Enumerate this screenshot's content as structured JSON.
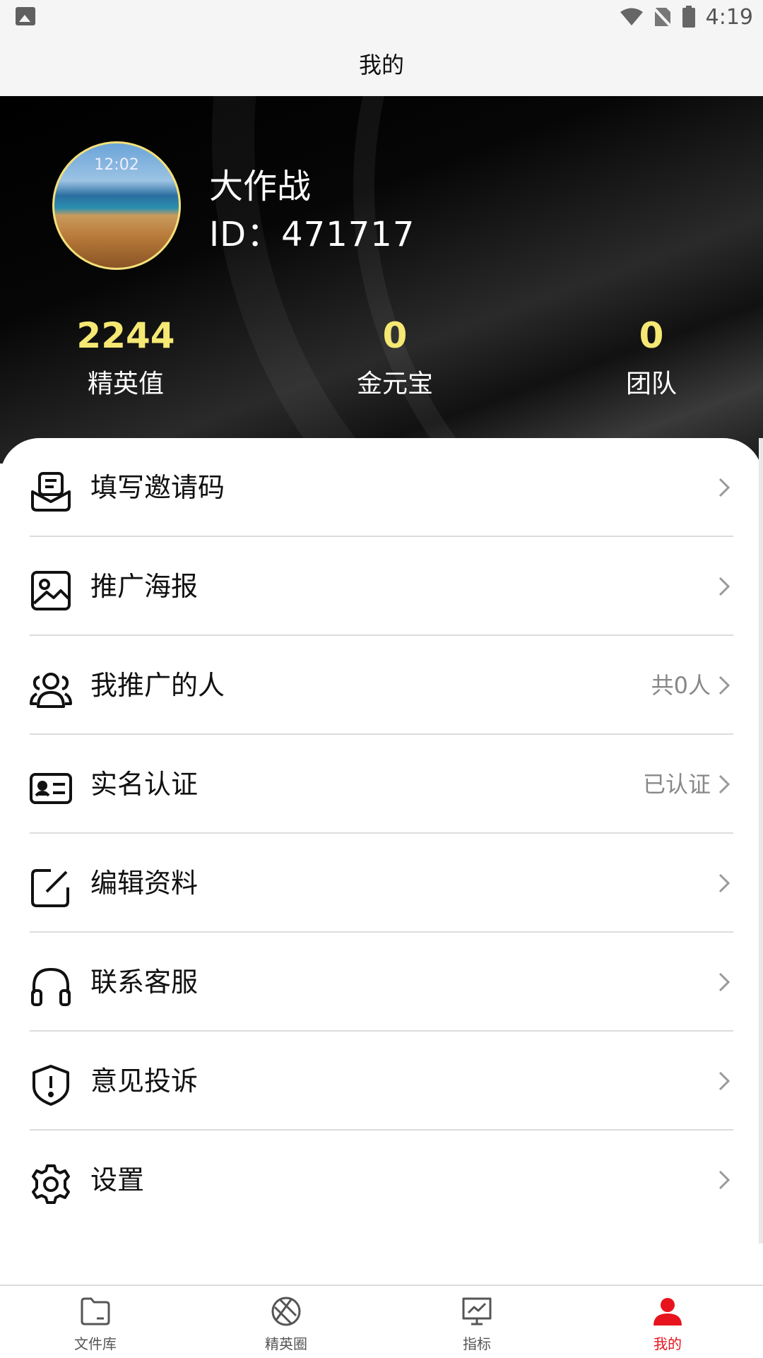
{
  "status_bar": {
    "time": "4:19"
  },
  "title": "我的",
  "profile": {
    "avatar_time": "12:02",
    "username": "大作战",
    "id_text": "ID：471717"
  },
  "stats": [
    {
      "value": "2244",
      "label": "精英值"
    },
    {
      "value": "0",
      "label": "金元宝"
    },
    {
      "value": "0",
      "label": "团队"
    }
  ],
  "menu": [
    {
      "label": "填写邀请码",
      "value": "",
      "icon": "invite-code-icon"
    },
    {
      "label": "推广海报",
      "value": "",
      "icon": "poster-icon"
    },
    {
      "label": "我推广的人",
      "value": "共0人",
      "icon": "users-icon"
    },
    {
      "label": "实名认证",
      "value": "已认证",
      "icon": "id-card-icon"
    },
    {
      "label": "编辑资料",
      "value": "",
      "icon": "edit-icon"
    },
    {
      "label": "联系客服",
      "value": "",
      "icon": "headphones-icon"
    },
    {
      "label": "意见投诉",
      "value": "",
      "icon": "complaint-shield-icon"
    },
    {
      "label": "设置",
      "value": "",
      "icon": "gear-icon"
    }
  ],
  "bottom_nav": [
    {
      "label": "文件库",
      "icon": "folder-icon",
      "active": false
    },
    {
      "label": "精英圈",
      "icon": "aperture-icon",
      "active": false
    },
    {
      "label": "指标",
      "icon": "chart-board-icon",
      "active": false
    },
    {
      "label": "我的",
      "icon": "person-icon",
      "active": true
    }
  ],
  "colors": {
    "accent_yellow": "#f5e873",
    "active_red": "#e8141d"
  }
}
